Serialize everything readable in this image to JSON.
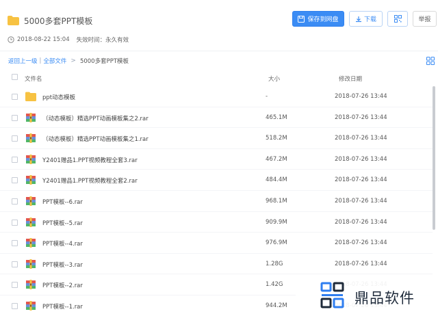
{
  "header": {
    "title": "5000多套PPT模板",
    "date": "2018-08-22 15:04",
    "expiry": "失效时间：永久有效",
    "save_label": "保存到网盘",
    "download_label": "下载",
    "report_label": "举报"
  },
  "breadcrumb": {
    "back": "返回上一级",
    "separator": "|",
    "all_files": "全部文件",
    "arrow": ">",
    "current": "5000多套PPT模板"
  },
  "table": {
    "col_name": "文件名",
    "col_size": "大小",
    "col_date": "修改日期",
    "rows": [
      {
        "name": "ppt动态模板",
        "size": "-",
        "date": "2018-07-26 13:44",
        "type": "folder"
      },
      {
        "name": "（动态模板）精选PPT动画模板集之2.rar",
        "size": "465.1M",
        "date": "2018-07-26 13:44",
        "type": "rar"
      },
      {
        "name": "（动态模板）精选PPT动画模板集之1.rar",
        "size": "518.2M",
        "date": "2018-07-26 13:44",
        "type": "rar"
      },
      {
        "name": "Y2401赠品1.PPT视频教程全套3.rar",
        "size": "467.2M",
        "date": "2018-07-26 13:44",
        "type": "rar"
      },
      {
        "name": "Y2401赠品1.PPT视频教程全套2.rar",
        "size": "484.4M",
        "date": "2018-07-26 13:44",
        "type": "rar"
      },
      {
        "name": "PPT模板--6.rar",
        "size": "968.1M",
        "date": "2018-07-26 13:44",
        "type": "rar"
      },
      {
        "name": "PPT模板--5.rar",
        "size": "909.9M",
        "date": "2018-07-26 13:44",
        "type": "rar"
      },
      {
        "name": "PPT模板--4.rar",
        "size": "976.9M",
        "date": "2018-07-26 13:44",
        "type": "rar"
      },
      {
        "name": "PPT模板--3.rar",
        "size": "1.28G",
        "date": "2018-07-26 13:44",
        "type": "rar"
      },
      {
        "name": "PPT模板--2.rar",
        "size": "1.42G",
        "date": "2018-07-26 13:44",
        "type": "rar"
      },
      {
        "name": "PPT模板--1.rar",
        "size": "944.2M",
        "date": "2018-07-26 13:44",
        "type": "rar"
      }
    ]
  },
  "watermark": {
    "text": "鼎品软件"
  },
  "colors": {
    "accent": "#3b8cf4",
    "folder": "#f7c242"
  }
}
